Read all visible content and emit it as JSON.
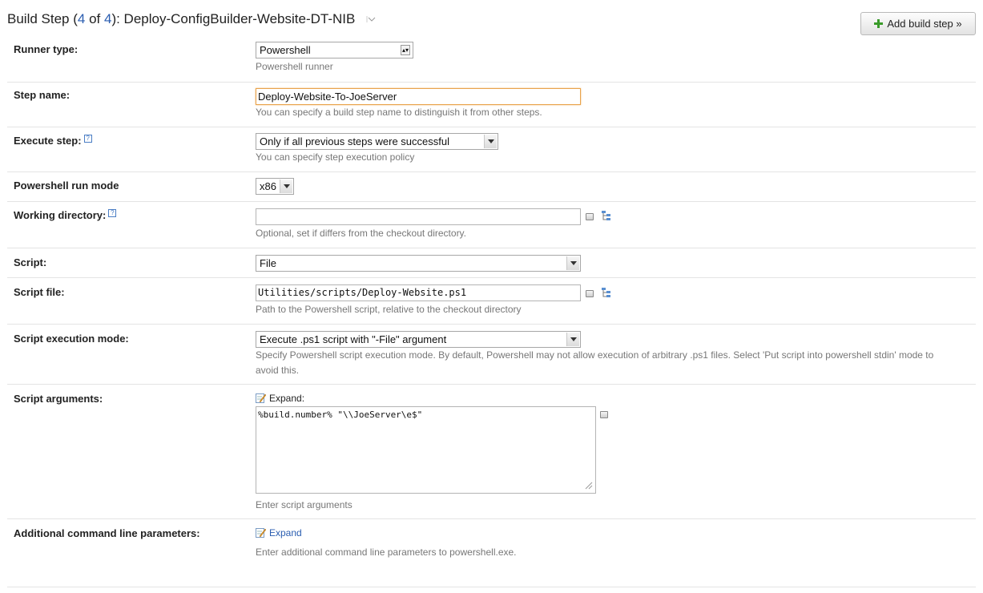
{
  "header": {
    "title_prefix": "Build Step (",
    "step_current": "4",
    "title_of": " of ",
    "step_total": "4",
    "title_suffix": "): Deploy-ConfigBuilder-Website-DT-NIB",
    "add_button_label": "Add build step »"
  },
  "runner_type": {
    "label": "Runner type:",
    "value": "Powershell",
    "note": "Powershell runner"
  },
  "step_name": {
    "label": "Step name:",
    "value": "Deploy-Website-To-JoeServer",
    "note": "You can specify a build step name to distinguish it from other steps."
  },
  "execute_step": {
    "label": "Execute step:",
    "value": "Only if all previous steps were successful",
    "note": "You can specify step execution policy"
  },
  "run_mode": {
    "label": "Powershell run mode",
    "value": "x86"
  },
  "working_directory": {
    "label": "Working directory:",
    "value": "",
    "note": "Optional, set if differs from the checkout directory."
  },
  "script": {
    "label": "Script:",
    "value": "File"
  },
  "script_file": {
    "label": "Script file:",
    "value": "Utilities/scripts/Deploy-Website.ps1",
    "note": "Path to the Powershell script, relative to the checkout directory"
  },
  "execution_mode": {
    "label": "Script execution mode:",
    "value": "Execute .ps1 script with \"-File\" argument",
    "note_line1": "Specify Powershell script execution mode. By default, Powershell may not allow execution of arbitrary .ps1 files. Select 'Put script into powershell stdin' mode to",
    "note_line2": "avoid this."
  },
  "script_arguments": {
    "label": "Script arguments:",
    "expand_label": "Expand:",
    "value": "%build.number% \"\\\\JoeServer\\e$\"",
    "note": "Enter script arguments"
  },
  "additional_params": {
    "label": "Additional command line parameters:",
    "expand_label": "Expand",
    "note": "Enter additional command line parameters to powershell.exe."
  },
  "icons": {
    "help": "help-icon",
    "tree": "tree-browse-icon",
    "expand": "expand-edit-icon",
    "plus": "plus-icon"
  },
  "colors": {
    "link": "#2a5db0",
    "focus_border": "#e9a24a",
    "plus_green": "#3a9b2a"
  }
}
